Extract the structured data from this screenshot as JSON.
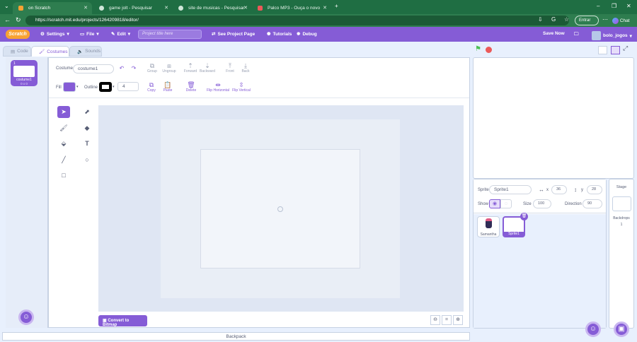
{
  "browser": {
    "tabs": [
      {
        "label": "on Scratch",
        "icon": "scratch-favicon",
        "active": true
      },
      {
        "label": "game jolt - Pesquisar",
        "icon": "search-favicon",
        "active": false
      },
      {
        "label": "site de musicas - Pesquisar",
        "icon": "search-favicon",
        "active": false
      },
      {
        "label": "Palco MP3 - Ouça o novo",
        "icon": "palco-favicon",
        "active": false
      }
    ],
    "url": "https://scratch.mit.edu/projects/1264209818/editor/",
    "entrar_label": "Entrar",
    "chat_label": "Chat"
  },
  "menubar": {
    "logo": "Scratch",
    "settings": "Settings",
    "file": "File",
    "edit": "Edit",
    "project_title_placeholder": "Project title here",
    "see_project_page": "See Project Page",
    "tutorials": "Tutorials",
    "debug": "Debug",
    "save_now": "Save Now",
    "username": "bolo_jogos"
  },
  "editor_tabs": {
    "code": "Code",
    "costumes": "Costumes",
    "sounds": "Sounds"
  },
  "costumes": [
    {
      "index": "1",
      "name": "costume1",
      "size": "0 x 0"
    }
  ],
  "paint": {
    "costume_label": "Costume",
    "costume_name": "costume1",
    "fill_label": "Fill",
    "fill_color": "#855cd6",
    "outline_label": "Outline",
    "outline_color": "#000000",
    "outline_width": "4",
    "buttons": {
      "group": "Group",
      "ungroup": "Ungroup",
      "forward": "Forward",
      "backward": "Backward",
      "front": "Front",
      "back": "Back",
      "copy": "Copy",
      "paste": "Paste",
      "delete": "Delete",
      "flip_horizontal": "Flip Horizontal",
      "flip_vertical": "Flip Vertical"
    },
    "convert_bitmap": "Convert to Bitmap",
    "zoom_reset": "="
  },
  "sprite_info": {
    "sprite_label": "Sprite",
    "sprite_name": "Sprite1",
    "x_label": "x",
    "x_value": "36",
    "y_label": "y",
    "y_value": "28",
    "show_label": "Show",
    "size_label": "Size",
    "size_value": "100",
    "direction_label": "Direction",
    "direction_value": "90"
  },
  "sprites": [
    {
      "name": "Samantha",
      "selected": false
    },
    {
      "name": "Sprite1",
      "selected": true
    }
  ],
  "stage_pane": {
    "title": "Stage",
    "backdrops_label": "Backdrops",
    "backdrops_count": "1"
  },
  "backpack_label": "Backpack",
  "colors": {
    "accent": "#855cd6",
    "browser_green": "#1f6e43",
    "editor_bg": "#e8f0fd",
    "go_flag": "#4cbf56",
    "stop": "#ec5959"
  }
}
